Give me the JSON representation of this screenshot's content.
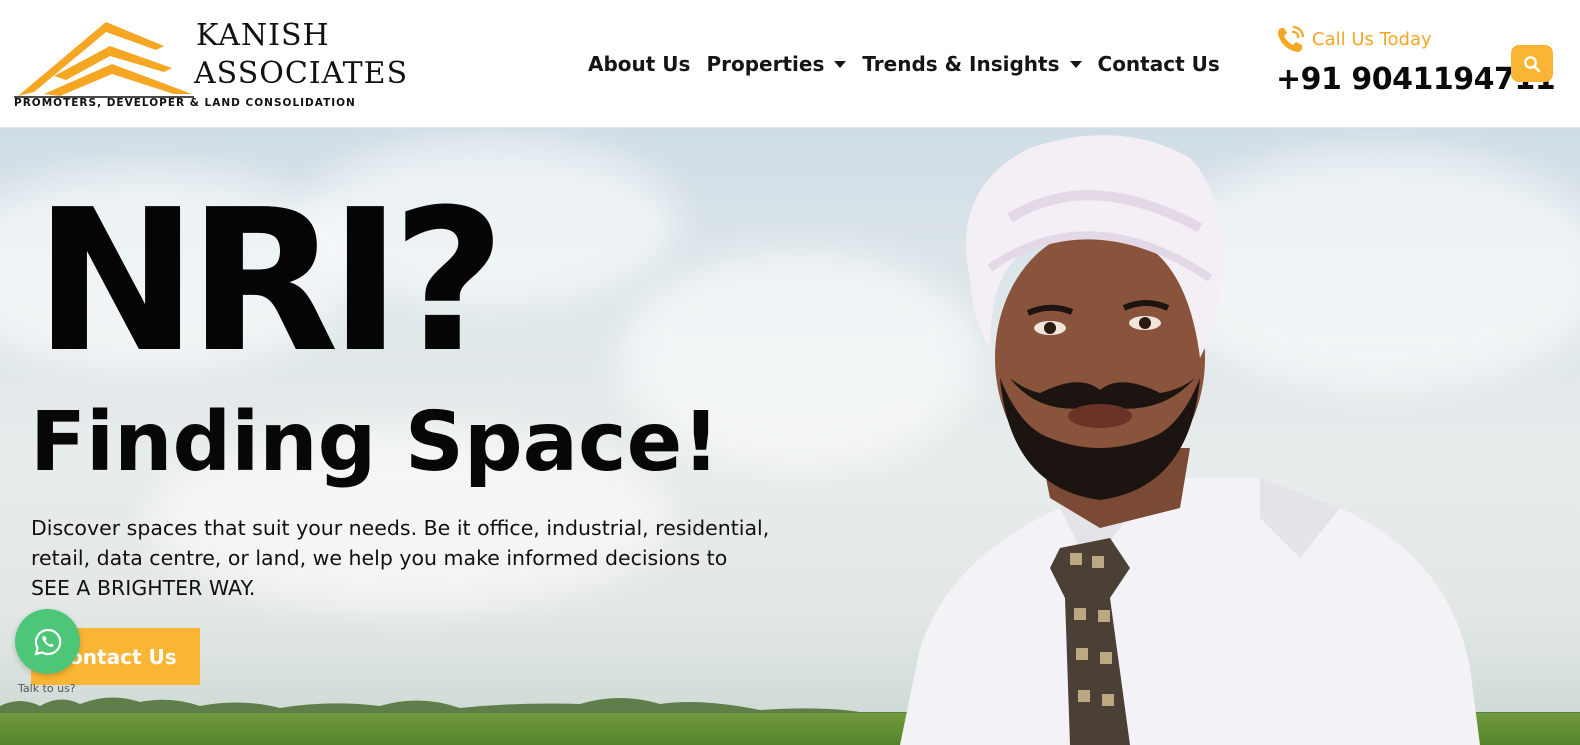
{
  "logo": {
    "name_line1": "KANISH",
    "name_line2": "ASSOCIATES",
    "tagline": "PROMOTERS, DEVELOPER & LAND CONSOLIDATION"
  },
  "nav": {
    "items": [
      {
        "label": "About Us",
        "has_dropdown": false
      },
      {
        "label": "Properties",
        "has_dropdown": true
      },
      {
        "label": "Trends & Insights",
        "has_dropdown": true
      },
      {
        "label": "Contact Us",
        "has_dropdown": false
      }
    ]
  },
  "call": {
    "label": "Call Us Today",
    "number": "+91 9041194711",
    "icon": "phone-icon"
  },
  "search": {
    "icon": "search-icon"
  },
  "hero": {
    "title": "NRI?",
    "subtitle": "Finding Space!",
    "description": "Discover spaces that suit your needs. Be it office, industrial, residential, retail, data centre, or land, we help you make informed decisions to SEE A BRIGHTER WAY.",
    "cta_label": "Contact Us"
  },
  "whatsapp": {
    "label": "Talk to us?",
    "icon": "whatsapp-icon"
  },
  "colors": {
    "accent": "#fbb534",
    "whatsapp": "#4dc777",
    "text": "#111111"
  }
}
